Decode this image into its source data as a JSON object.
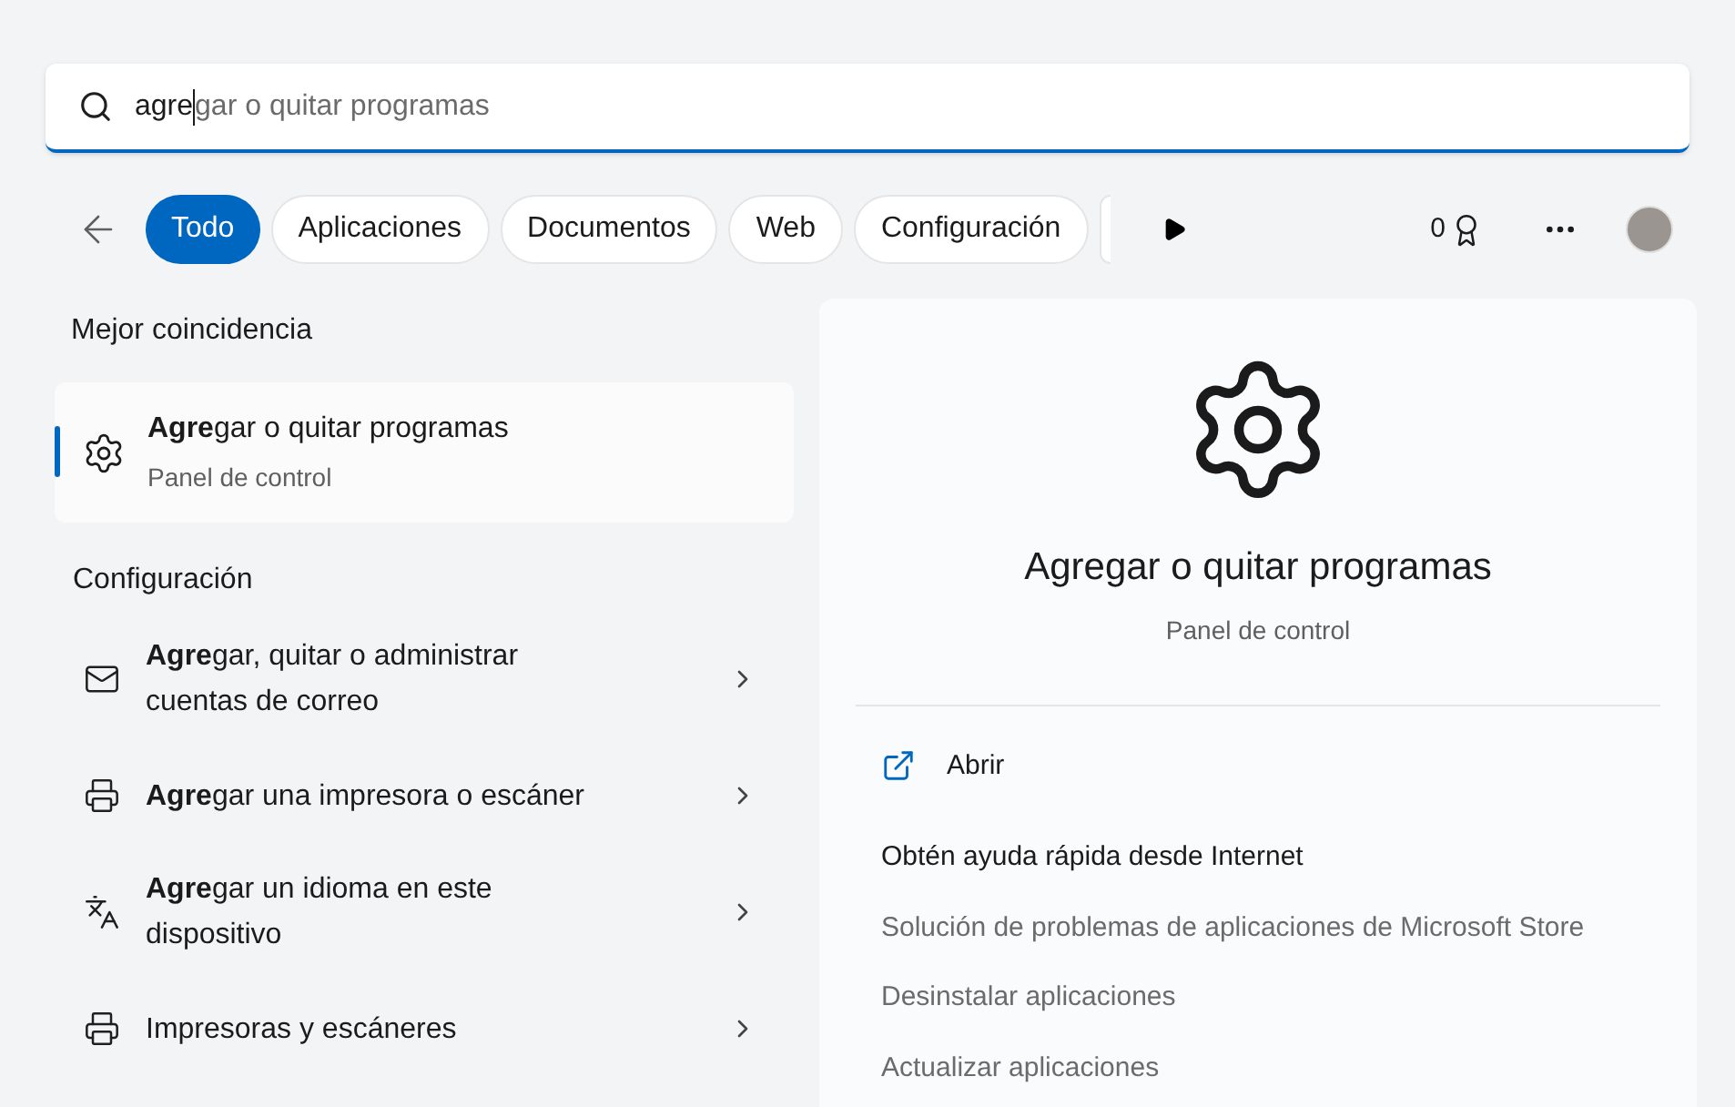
{
  "search": {
    "value": "agre",
    "completion": "gar o quitar programas"
  },
  "filters": [
    {
      "label": "Todo",
      "selected": true
    },
    {
      "label": "Aplicaciones",
      "selected": false
    },
    {
      "label": "Documentos",
      "selected": false
    },
    {
      "label": "Web",
      "selected": false
    },
    {
      "label": "Configuración",
      "selected": false
    }
  ],
  "points": "0",
  "best_match": {
    "heading": "Mejor coincidencia",
    "title": "**Agre**gar o quitar programas",
    "subtitle": "Panel de control",
    "selected": true
  },
  "settings": {
    "heading": "Configuración",
    "items": [
      {
        "kind": "mail",
        "title": "**Agre**gar, quitar o administrar cuentas de correo"
      },
      {
        "kind": "printer",
        "title": "**Agre**gar una impresora o escáner"
      },
      {
        "kind": "language",
        "title": "**Agre**gar un idioma en este dispositivo"
      },
      {
        "kind": "printer",
        "title": "Impresoras y escáneres"
      }
    ]
  },
  "preview": {
    "title": "Agregar o quitar programas",
    "subtitle": "Panel de control",
    "open_action": "Abrir",
    "help_heading": "Obtén ayuda rápida desde Internet",
    "help_links": [
      "Solución de problemas de aplicaciones de Microsoft Store",
      "Desinstalar aplicaciones",
      "Actualizar aplicaciones"
    ]
  }
}
